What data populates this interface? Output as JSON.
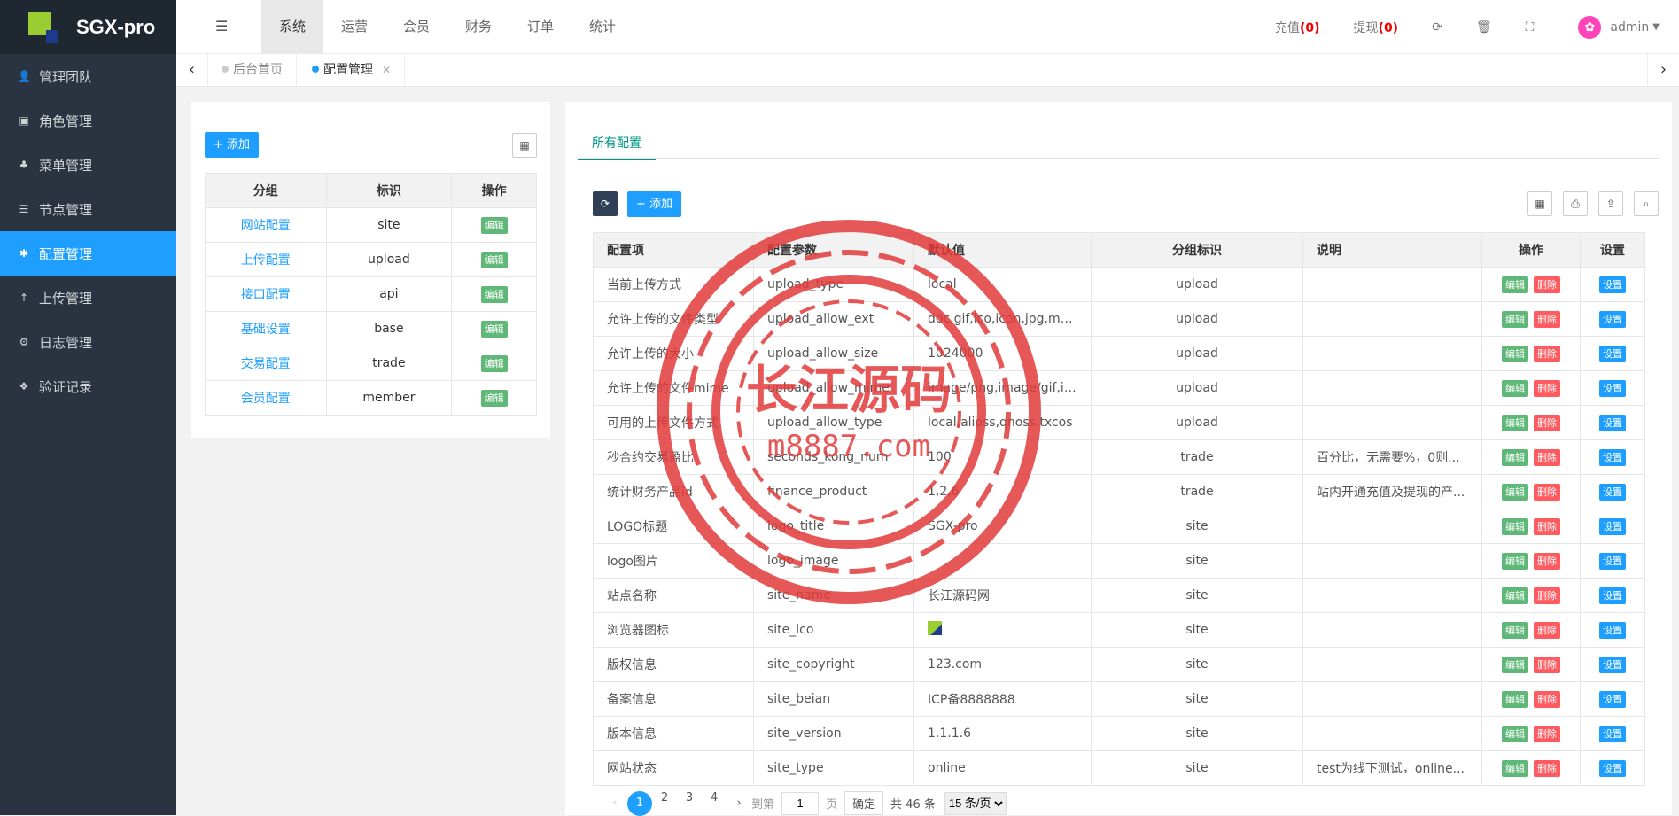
{
  "brand": {
    "name": "SGX-pro"
  },
  "sidebar": {
    "items": [
      {
        "label": "管理团队",
        "icon": "user-icon",
        "glyph": "👤",
        "active": false
      },
      {
        "label": "角色管理",
        "icon": "role-icon",
        "glyph": "▣",
        "active": false
      },
      {
        "label": "菜单管理",
        "icon": "tree-icon",
        "glyph": "♣",
        "active": false
      },
      {
        "label": "节点管理",
        "icon": "list-icon",
        "glyph": "☰",
        "active": false
      },
      {
        "label": "配置管理",
        "icon": "gear-icon",
        "glyph": "✱",
        "active": true
      },
      {
        "label": "上传管理",
        "icon": "upload-icon",
        "glyph": "↑",
        "active": false
      },
      {
        "label": "日志管理",
        "icon": "log-icon",
        "glyph": "⚙",
        "active": false
      },
      {
        "label": "验证记录",
        "icon": "verify-icon",
        "glyph": "❖",
        "active": false
      }
    ]
  },
  "topnav": {
    "items": [
      "系统",
      "运营",
      "会员",
      "财务",
      "订单",
      "统计"
    ]
  },
  "topright": {
    "recharge_label": "充值",
    "recharge_count": "(0)",
    "withdraw_label": "提现",
    "withdraw_count": "(0)",
    "user": "admin"
  },
  "tabs": [
    {
      "label": "后台首页"
    },
    {
      "label": "配置管理"
    }
  ],
  "left": {
    "add_label": "+ 添加",
    "headers": [
      "分组",
      "标识",
      "操作"
    ],
    "edit_label": "编辑",
    "rows": [
      {
        "group": "网站配置",
        "key": "site"
      },
      {
        "group": "上传配置",
        "key": "upload"
      },
      {
        "group": "接口配置",
        "key": "api"
      },
      {
        "group": "基础设置",
        "key": "base"
      },
      {
        "group": "交易配置",
        "key": "trade"
      },
      {
        "group": "会员配置",
        "key": "member"
      }
    ]
  },
  "right": {
    "tab_label": "所有配置",
    "add_label": "+ 添加",
    "headers": [
      "配置项",
      "配置参数",
      "默认值",
      "分组标识",
      "说明",
      "操作",
      "设置"
    ],
    "edit_label": "编辑",
    "delete_label": "删除",
    "set_label": "设置",
    "rows": [
      {
        "name": "当前上传方式",
        "param": "upload_type",
        "value": "local",
        "group": "upload",
        "desc": ""
      },
      {
        "name": "允许上传的文件类型",
        "param": "upload_allow_ext",
        "value": "doc,gif,ico,icon,jpg,mp3,...",
        "group": "upload",
        "desc": ""
      },
      {
        "name": "允许上传的大小",
        "param": "upload_allow_size",
        "value": "1024000",
        "group": "upload",
        "desc": ""
      },
      {
        "name": "允许上传的文件mime",
        "param": "upload_allow_mime",
        "value": "image/png,image/gif,ima...",
        "group": "upload",
        "desc": ""
      },
      {
        "name": "可用的上传文件方式",
        "param": "upload_allow_type",
        "value": "local,alioss,qnoss,txcos",
        "group": "upload",
        "desc": ""
      },
      {
        "name": "秒合约交易盈比",
        "param": "seconds_kong_num",
        "value": "100",
        "group": "trade",
        "desc": "百分比，无需要%，0则..."
      },
      {
        "name": "统计财务产品id",
        "param": "finance_product",
        "value": "1,2,6",
        "group": "trade",
        "desc": "站内开通充值及提现的产..."
      },
      {
        "name": "LOGO标题",
        "param": "logo_title",
        "value": "SGX-pro",
        "group": "site",
        "desc": ""
      },
      {
        "name": "logo图片",
        "param": "logo_image",
        "value": "",
        "group": "site",
        "desc": ""
      },
      {
        "name": "站点名称",
        "param": "site_name",
        "value": "长江源码网",
        "group": "site",
        "desc": ""
      },
      {
        "name": "浏览器图标",
        "param": "site_ico",
        "value": "",
        "group": "site",
        "desc": ""
      },
      {
        "name": "版权信息",
        "param": "site_copyright",
        "value": "123.com",
        "group": "site",
        "desc": ""
      },
      {
        "name": "备案信息",
        "param": "site_beian",
        "value": "ICP备8888888",
        "group": "site",
        "desc": ""
      },
      {
        "name": "版本信息",
        "param": "site_version",
        "value": "1.1.1.6",
        "group": "site",
        "desc": ""
      },
      {
        "name": "网站状态",
        "param": "site_type",
        "value": "online",
        "group": "site",
        "desc": "test为线下测试，online..."
      }
    ]
  },
  "pager": {
    "pages": [
      "1",
      "2",
      "3",
      "4"
    ],
    "goto_label": "到第",
    "page_value": "1",
    "page_unit": "页",
    "ok_label": "确定",
    "total": "共 46 条",
    "per_page": "15 条/页"
  },
  "watermark": {
    "line1": "长江源码",
    "line2": "m8887.com"
  }
}
